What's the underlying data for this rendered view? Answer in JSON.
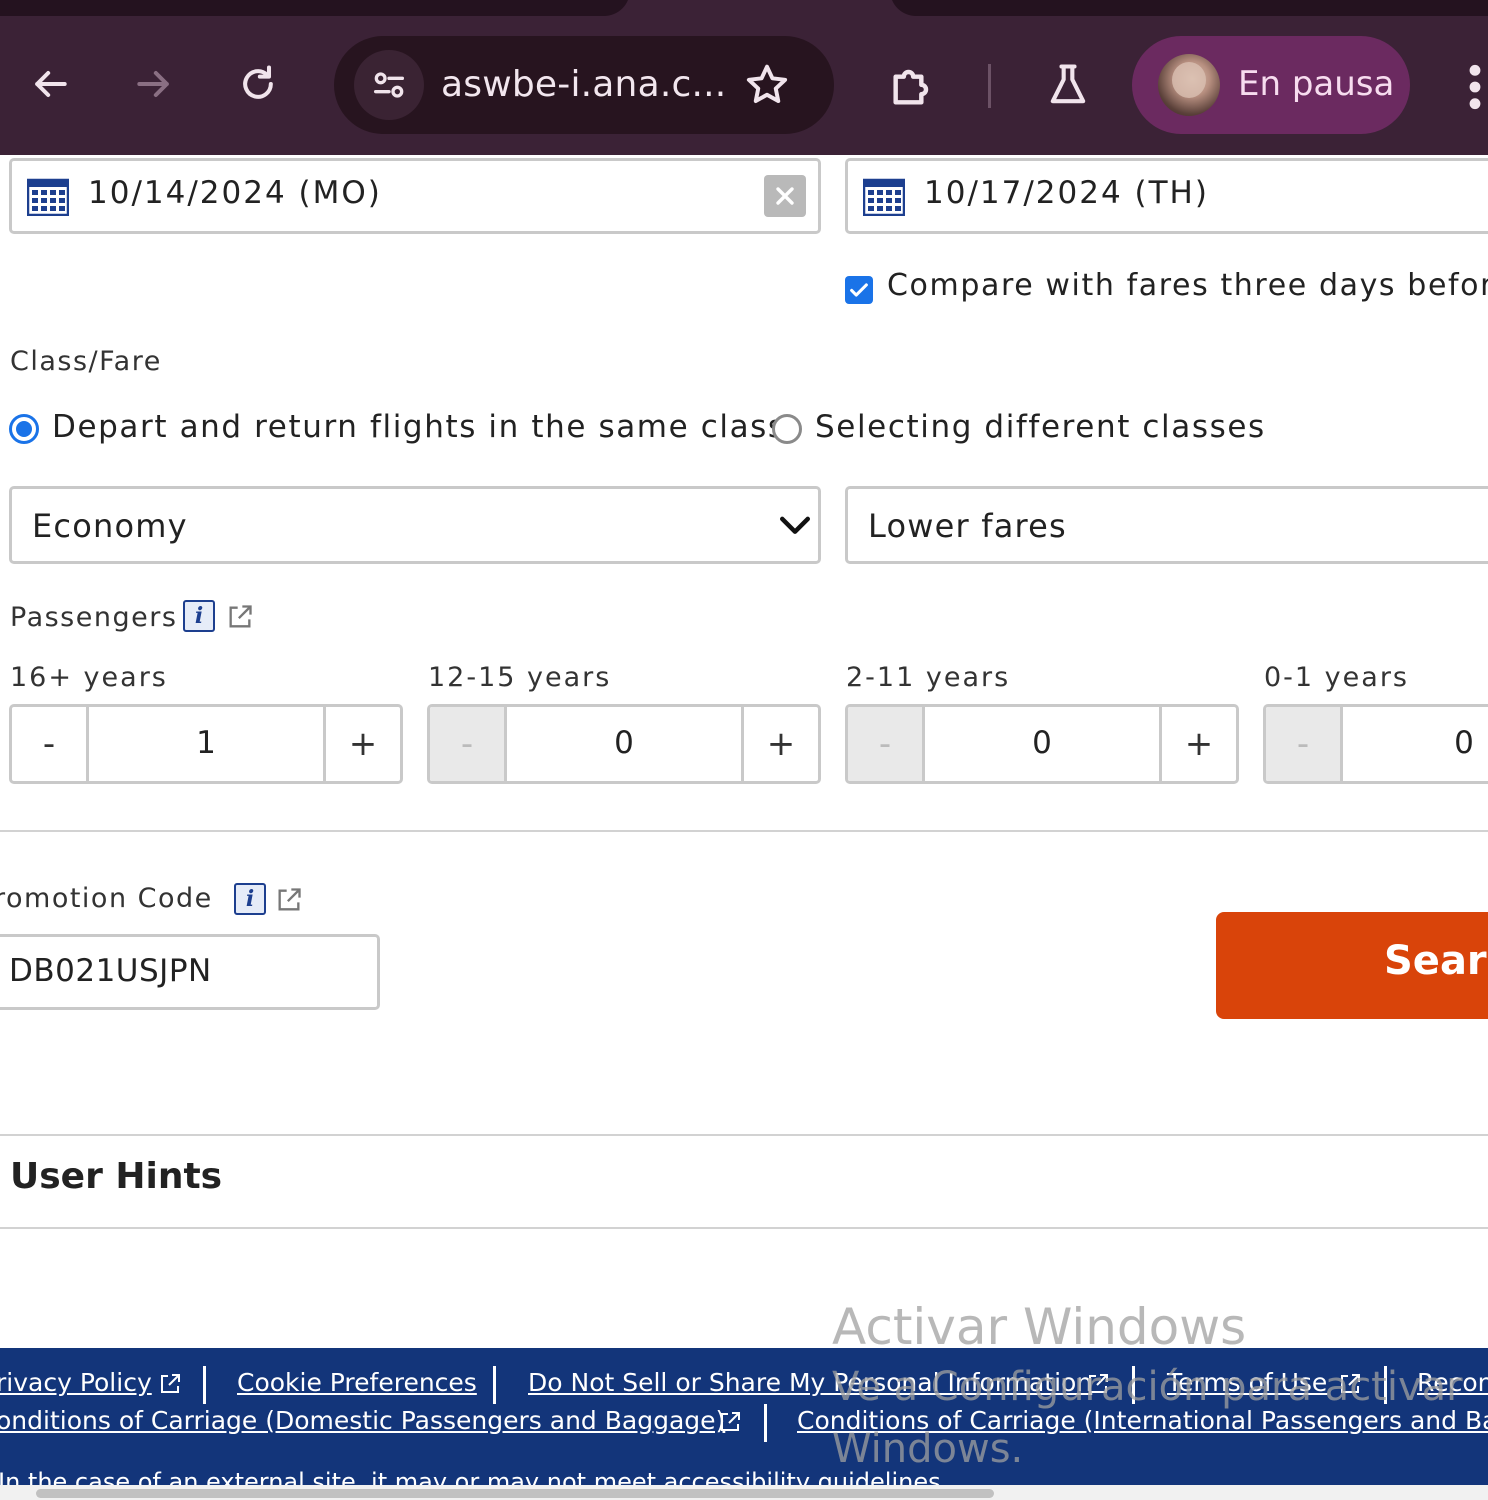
{
  "browser": {
    "url": "aswbe-i.ana.c...",
    "profile_status": "En pausa"
  },
  "dates": {
    "depart": "10/14/2024 (MO)",
    "return": "10/17/2024 (TH)",
    "compare_label": "Compare with fares three days before",
    "compare_checked": true
  },
  "class_fare": {
    "label": "Class/Fare",
    "option_same": "Depart and return flights in the same class",
    "option_different": "Selecting different classes",
    "selected_option": "same",
    "cabin_value": "Economy",
    "fare_value": "Lower fares"
  },
  "passengers": {
    "label": "Passengers",
    "groups": [
      {
        "age": "16+ years",
        "count": "1",
        "minus_enabled": true
      },
      {
        "age": "12-15 years",
        "count": "0",
        "minus_enabled": false
      },
      {
        "age": "2-11 years",
        "count": "0",
        "minus_enabled": false
      },
      {
        "age": "0-1 years",
        "count": "0",
        "minus_enabled": false
      }
    ],
    "minus_symbol": "-",
    "plus_symbol": "+"
  },
  "promotion": {
    "label": "romotion Code",
    "value": "DB021USJPN"
  },
  "search_button": "Searc",
  "user_hints": "User Hints",
  "watermark": {
    "line1": "Activar Windows",
    "line2": "Ve a Configuración para activar",
    "line3": "Windows."
  },
  "footer": {
    "row1": [
      "rivacy Policy",
      "Cookie Preferences",
      "Do Not Sell or Share My Personal Information",
      "Terms of Use",
      "Recon"
    ],
    "row2": [
      "onditions of Carriage (Domestic Passengers and Baggage)",
      "Conditions of Carriage (International Passengers and Bag"
    ],
    "note": "In the case of an external site, it may or may not meet accessibility guidelines."
  },
  "colors": {
    "browser_frame": "#3b2236",
    "accent_blue": "#1a73e8",
    "search_orange": "#d9440a",
    "footer_navy": "#13357a"
  }
}
